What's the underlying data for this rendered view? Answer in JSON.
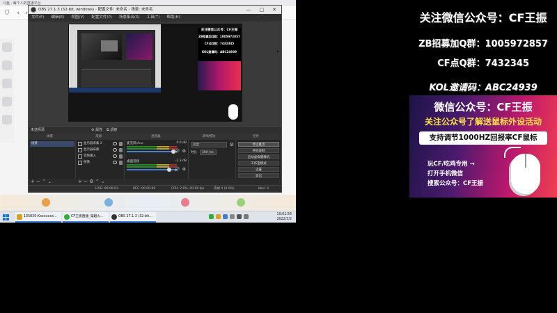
{
  "browser": {
    "tab_title": "斗鱼 · 每个人的直播平台"
  },
  "obs": {
    "title": "OBS 27.1.3 (32-bit, windows) - 配置文件: 未命名 - 场景: 未命名",
    "window_buttons": {
      "minimize": "—",
      "maximize": "□",
      "close": "✕"
    },
    "menu": [
      "文件(F)",
      "编辑(E)",
      "视图(V)",
      "配置文件(P)",
      "场景集合(S)",
      "工具(T)",
      "帮助(H)"
    ],
    "preview_ad_lines": [
      "关注微信公众号：CF王振",
      "ZB招募加Q群：1005972857",
      "CF点Q群：7432345",
      "KOL邀请码：ABC24939"
    ],
    "dock_bar": "未选择源",
    "dock_bar_buttons": [
      "属性",
      "滤镜"
    ],
    "docks": {
      "scenes": "场景",
      "sources": "来源",
      "mixer": "混音器",
      "transitions": "转场特效",
      "controls": "控件"
    },
    "scenes": [
      "场景"
    ],
    "sources": [
      "显示器采集 2",
      "显示器采集",
      "音频输入",
      "图像"
    ],
    "mixer": [
      {
        "name": "麦克风/Aux",
        "db": "0.0 dB"
      },
      {
        "name": "桌面音频",
        "db": "-2.3 dB"
      }
    ],
    "transitions": {
      "selected": "淡出",
      "duration_label": "时长",
      "duration": "300 ms"
    },
    "controls": [
      "停止推流",
      "开始录制",
      "启动虚拟摄像机",
      "工作室模式",
      "设置",
      "退出"
    ],
    "status": {
      "dropped": "丢帧 0 (0.0%)",
      "live": "LIVE: 00:00:03",
      "rec": "REC: 00:00:00",
      "cpu": "CPU: 2.6%, 60.00 fps",
      "kbps": "kb/s: 0"
    }
  },
  "taskbar": {
    "apps": [
      {
        "label": "135835-Kxxxxxxx...",
        "color": "#d8a21a"
      },
      {
        "label": "CF王振直播_穿越火...",
        "color": "#2fae3a"
      },
      {
        "label": "OBS 27.1.3 (32-bit...",
        "color": "#333333"
      }
    ],
    "clock_time": "19:01:56",
    "clock_date": "2022/3/2"
  },
  "overlay": {
    "line1": "关注微信公众号：CF王振",
    "line2": "ZB招募加Q群：1005972857",
    "line3": "CF点Q群：7432345",
    "line4": "KOL邀请码：ABC24939",
    "banner_title": "微信公众号：CF王振",
    "banner_sub": "关注公众号了解送鼠标外设活动",
    "banner_box": "支持调节1000HZ回报率CF鼠标",
    "banner_small1": "玩CF/吃鸡专用 →",
    "banner_small2": "打开手机微信",
    "banner_small3": "搜索公众号：CF王振"
  },
  "colors": {
    "accent_yellow": "#ffe24a",
    "obs_bg": "#2b2b2b",
    "taskbar": "#dfe4ea"
  }
}
